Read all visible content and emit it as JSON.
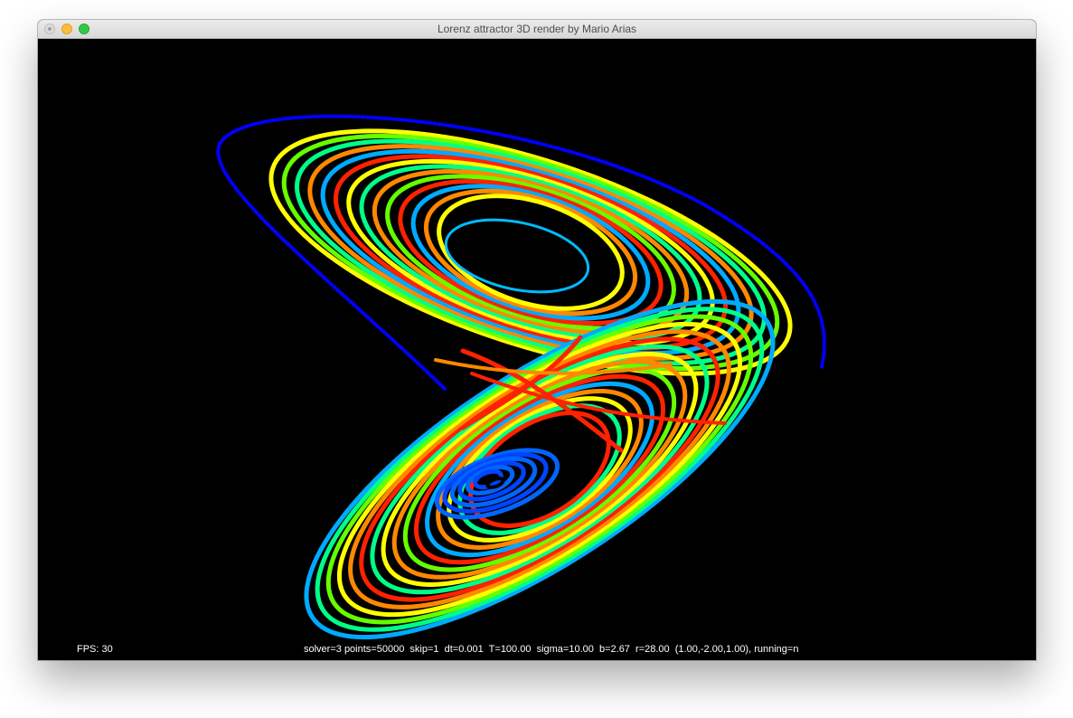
{
  "window": {
    "title": "Lorenz attractor 3D render by Mario Arias"
  },
  "hud": {
    "fps_label": "FPS: 30",
    "status": "solver=3 points=50000  skip=1  dt=0.001  T=100.00  sigma=10.00  b=2.67  r=28.00  (1.00,-2.00,1.00), running=n"
  },
  "render": {
    "background": "#000000",
    "palette": [
      "#0000ff",
      "#0044ff",
      "#00aaff",
      "#00ff88",
      "#66ff00",
      "#ffff00",
      "#ff8800",
      "#ff2200"
    ]
  }
}
